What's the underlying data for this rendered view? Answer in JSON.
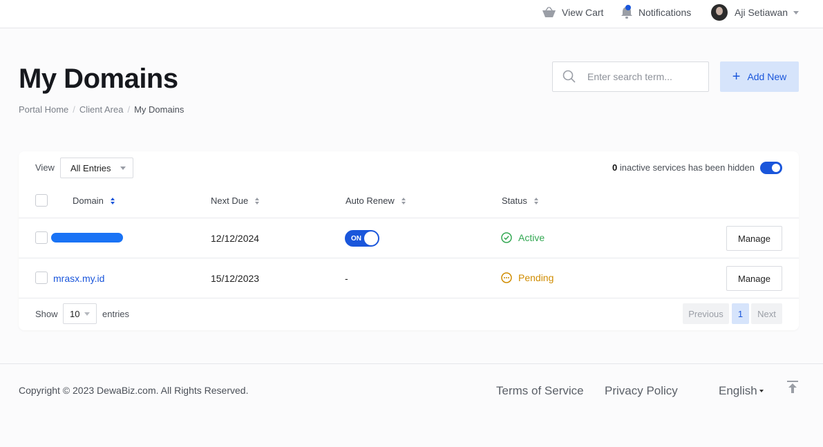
{
  "topbar": {
    "cart_icon": "basket-icon",
    "cart_label": "View Cart",
    "notifications_icon": "bell-icon",
    "notifications_label": "Notifications",
    "user_name": "Aji Setiawan"
  },
  "header": {
    "title": "My Domains",
    "breadcrumb": [
      "Portal Home",
      "Client Area",
      "My Domains"
    ],
    "search_placeholder": "Enter search term...",
    "add_label": "Add New"
  },
  "table": {
    "view_label": "View",
    "view_value": "All Entries",
    "inactive_count": "0",
    "inactive_text": " inactive services has been hidden",
    "inactive_toggle_on": true,
    "columns": [
      "Domain",
      "Next Due",
      "Auto Renew",
      "Status"
    ],
    "rows": [
      {
        "domain": "",
        "redacted": true,
        "next_due": "12/12/2024",
        "auto_renew": "ON",
        "status": "Active",
        "action": "Manage"
      },
      {
        "domain": "mrasx.my.id",
        "redacted": false,
        "next_due": "15/12/2023",
        "auto_renew": "-",
        "status": "Pending",
        "action": "Manage"
      }
    ],
    "show_label": "Show",
    "page_length": "10",
    "entries_label": "entries",
    "pagination": {
      "previous": "Previous",
      "current": "1",
      "next": "Next"
    }
  },
  "footer": {
    "copyright": "Copyright © 2023 DewaBiz.com. All Rights Reserved.",
    "terms": "Terms of Service",
    "privacy": "Privacy Policy",
    "language": "English",
    "top_icon": "arrow-up-to-top-icon"
  },
  "colors": {
    "primary": "#1a56db",
    "primary_light": "#d6e4fb",
    "active": "#34a853",
    "pending": "#d08c00"
  }
}
